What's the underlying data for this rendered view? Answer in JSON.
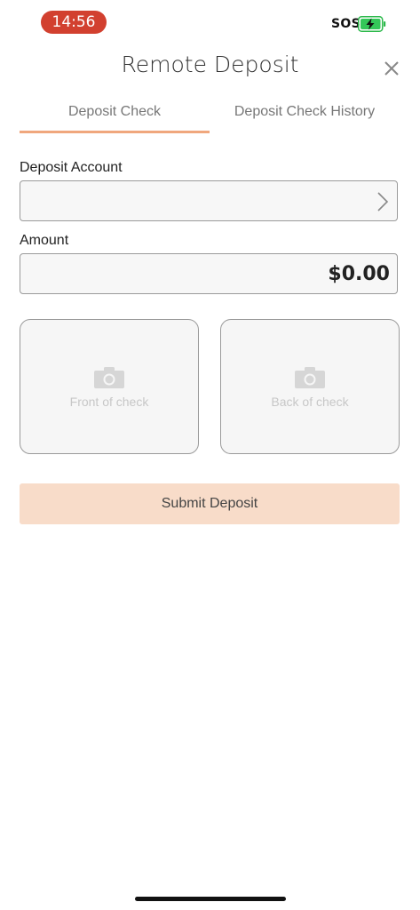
{
  "status_bar": {
    "time": "14:56",
    "sos": "SOS",
    "battery_icon": "battery-charging-icon",
    "time_pill_color": "#d2402f"
  },
  "header": {
    "title": "Remote Deposit",
    "close_icon": "close-icon"
  },
  "tabs": [
    {
      "label": "Deposit Check",
      "active": true
    },
    {
      "label": "Deposit Check History",
      "active": false
    }
  ],
  "form": {
    "deposit_account_label": "Deposit Account",
    "deposit_account_value": "",
    "amount_label": "Amount",
    "amount_value": "$0.00"
  },
  "check_images": {
    "front_label": "Front of check",
    "back_label": "Back of check",
    "camera_icon": "camera-icon"
  },
  "submit": {
    "label": "Submit Deposit"
  },
  "colors": {
    "accent": "#f0a77d",
    "submit_background": "#f8dcc9"
  }
}
